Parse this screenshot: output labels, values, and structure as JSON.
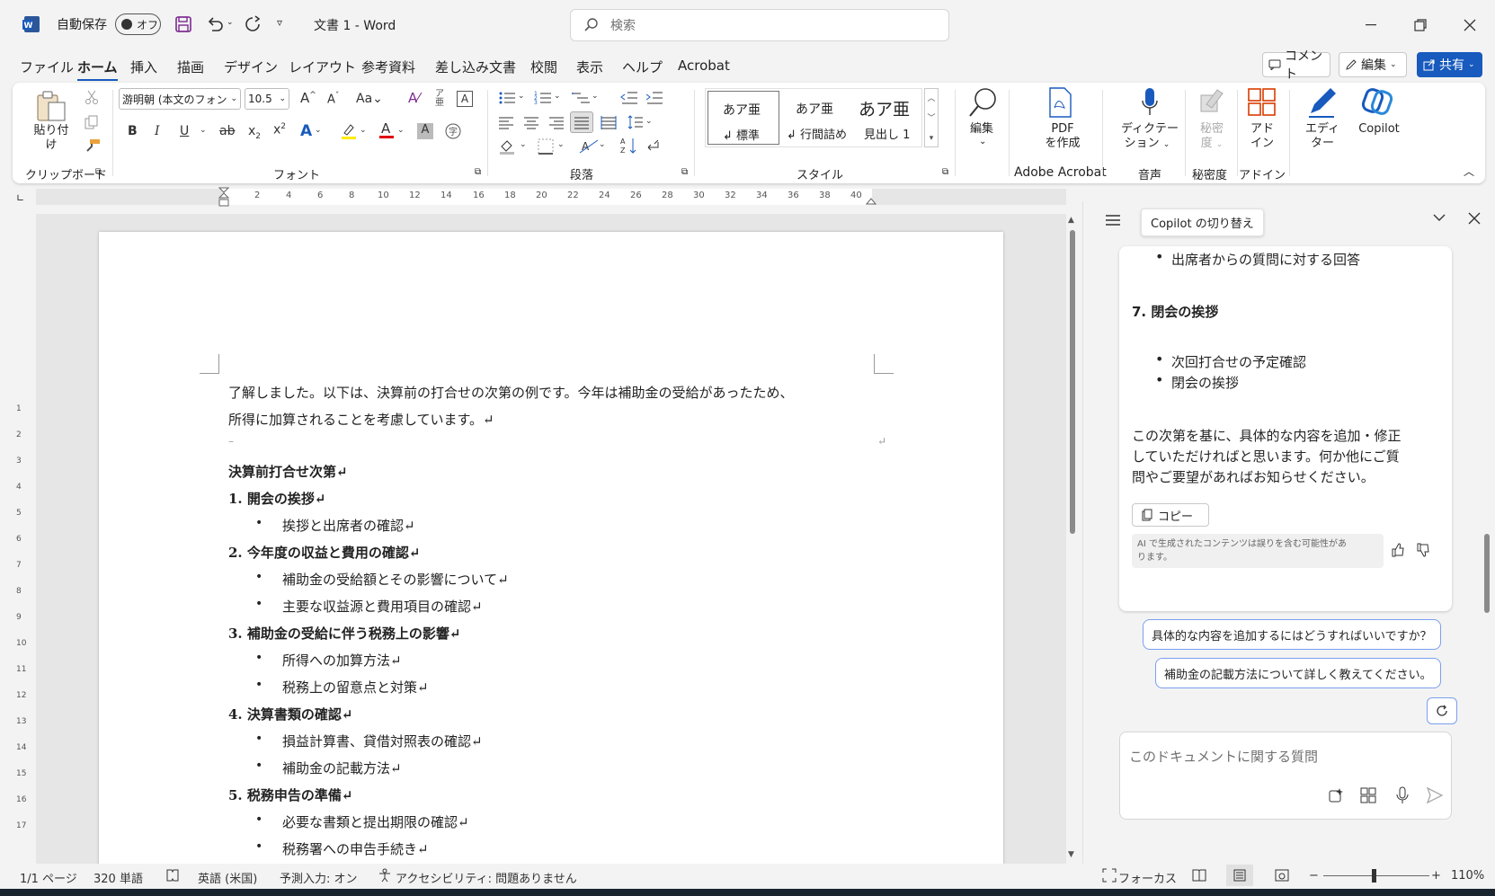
{
  "titlebar": {
    "autosave_label": "自動保存",
    "autosave_state": "オフ",
    "doc_title": "文書 1  -  Word",
    "search_placeholder": "検索"
  },
  "tabs": [
    "ファイル",
    "ホーム",
    "挿入",
    "描画",
    "デザイン",
    "レイアウト",
    "参考資料",
    "差し込み文書",
    "校閲",
    "表示",
    "ヘルプ",
    "Acrobat"
  ],
  "active_tab": "ホーム",
  "right_buttons": {
    "comment": "コメント",
    "edit": "編集",
    "share": "共有"
  },
  "ribbon": {
    "clipboard": {
      "paste": "貼り付け",
      "label": "クリップボード"
    },
    "font": {
      "name": "游明朝 (本文のフォン",
      "size": "10.5",
      "label": "フォント"
    },
    "paragraph": {
      "label": "段落"
    },
    "styles": {
      "label": "スタイル",
      "items": [
        {
          "sample": "あア亜",
          "name": "↲ 標準"
        },
        {
          "sample": "あア亜",
          "name": "↲ 行間詰め"
        },
        {
          "sample": "あア亜",
          "name": "見出し 1"
        }
      ]
    },
    "editing": {
      "label": "編集"
    },
    "acrobat": {
      "pdf_line1": "PDF",
      "pdf_line2": "を作成",
      "label": "Adobe Acrobat"
    },
    "voice": {
      "line1": "ディクテー",
      "line2": "ション",
      "label": "音声"
    },
    "sensitivity": {
      "line1": "秘密",
      "line2": "度",
      "label": "秘密度"
    },
    "addins": {
      "line1": "アド",
      "line2": "イン",
      "label": "アドイン"
    },
    "editor": {
      "line1": "エディ",
      "line2": "ター"
    },
    "copilot": {
      "label": "Copilot"
    }
  },
  "ruler_numbers": [
    "2",
    "4",
    "6",
    "8",
    "10",
    "12",
    "14",
    "16",
    "18",
    "20",
    "22",
    "24",
    "26",
    "28",
    "30",
    "32",
    "34",
    "36",
    "38",
    "40"
  ],
  "vruler_numbers": [
    "1",
    "2",
    "3",
    "4",
    "5",
    "6",
    "7",
    "8",
    "9",
    "10",
    "11",
    "12",
    "13",
    "14",
    "15",
    "16",
    "17"
  ],
  "document": {
    "intro1": "了解しました。以下は、決算前の打合せの次第の例です。今年は補助金の受給があったため、",
    "intro2": "所得に加算されることを考慮しています。↵",
    "heading": "決算前打合せ次第↵",
    "s1": "1.  開会の挨拶↵",
    "s1b1": "挨拶と出席者の確認↵",
    "s2": "2.  今年度の収益と費用の確認↵",
    "s2b1": "補助金の受給額とその影響について↵",
    "s2b2": "主要な収益源と費用項目の確認↵",
    "s3": "3.  補助金の受給に伴う税務上の影響↵",
    "s3b1": "所得への加算方法↵",
    "s3b2": "税務上の留意点と対策↵",
    "s4": "4.  決算書類の確認↵",
    "s4b1": "損益計算書、貸借対照表の確認↵",
    "s4b2": "補助金の記載方法↵",
    "s5": "5.  税務申告の準備↵",
    "s5b1": "必要な書類と提出期限の確認↵",
    "s5b2": "税務署への申告手続き↵"
  },
  "copilot": {
    "tooltip": "Copilot の切り替え",
    "bullet_top": "出席者からの質問に対する回答",
    "section7": "7. 閉会の挨拶",
    "b7_1": "次回打合せの予定確認",
    "b7_2": "閉会の挨拶",
    "closing1": "この次第を基に、具体的な内容を追加・修正",
    "closing2": "していただければと思います。何か他にご質",
    "closing3": "問やご要望があればお知らせください。",
    "copy_button": "コピー",
    "disclaimer1": "AI で生成されたコンテンツは誤りを含む可能性があ",
    "disclaimer2": "ります。",
    "suggestion1": "具体的な内容を追加するにはどうすればいいですか？",
    "suggestion2": "補助金の記載方法について詳しく教えてください。",
    "input_placeholder": "このドキュメントに関する質問"
  },
  "status": {
    "page": "1/1 ページ",
    "words": "320 単語",
    "language": "英語 (米国)",
    "predictive": "予測入力: オン",
    "accessibility": "アクセシビリティ: 問題ありません",
    "focus": "フォーカス",
    "zoom": "110%"
  },
  "colors": {
    "accent": "#185abd",
    "word_blue": "#2b579a",
    "save_purple": "#7a2b8f"
  }
}
